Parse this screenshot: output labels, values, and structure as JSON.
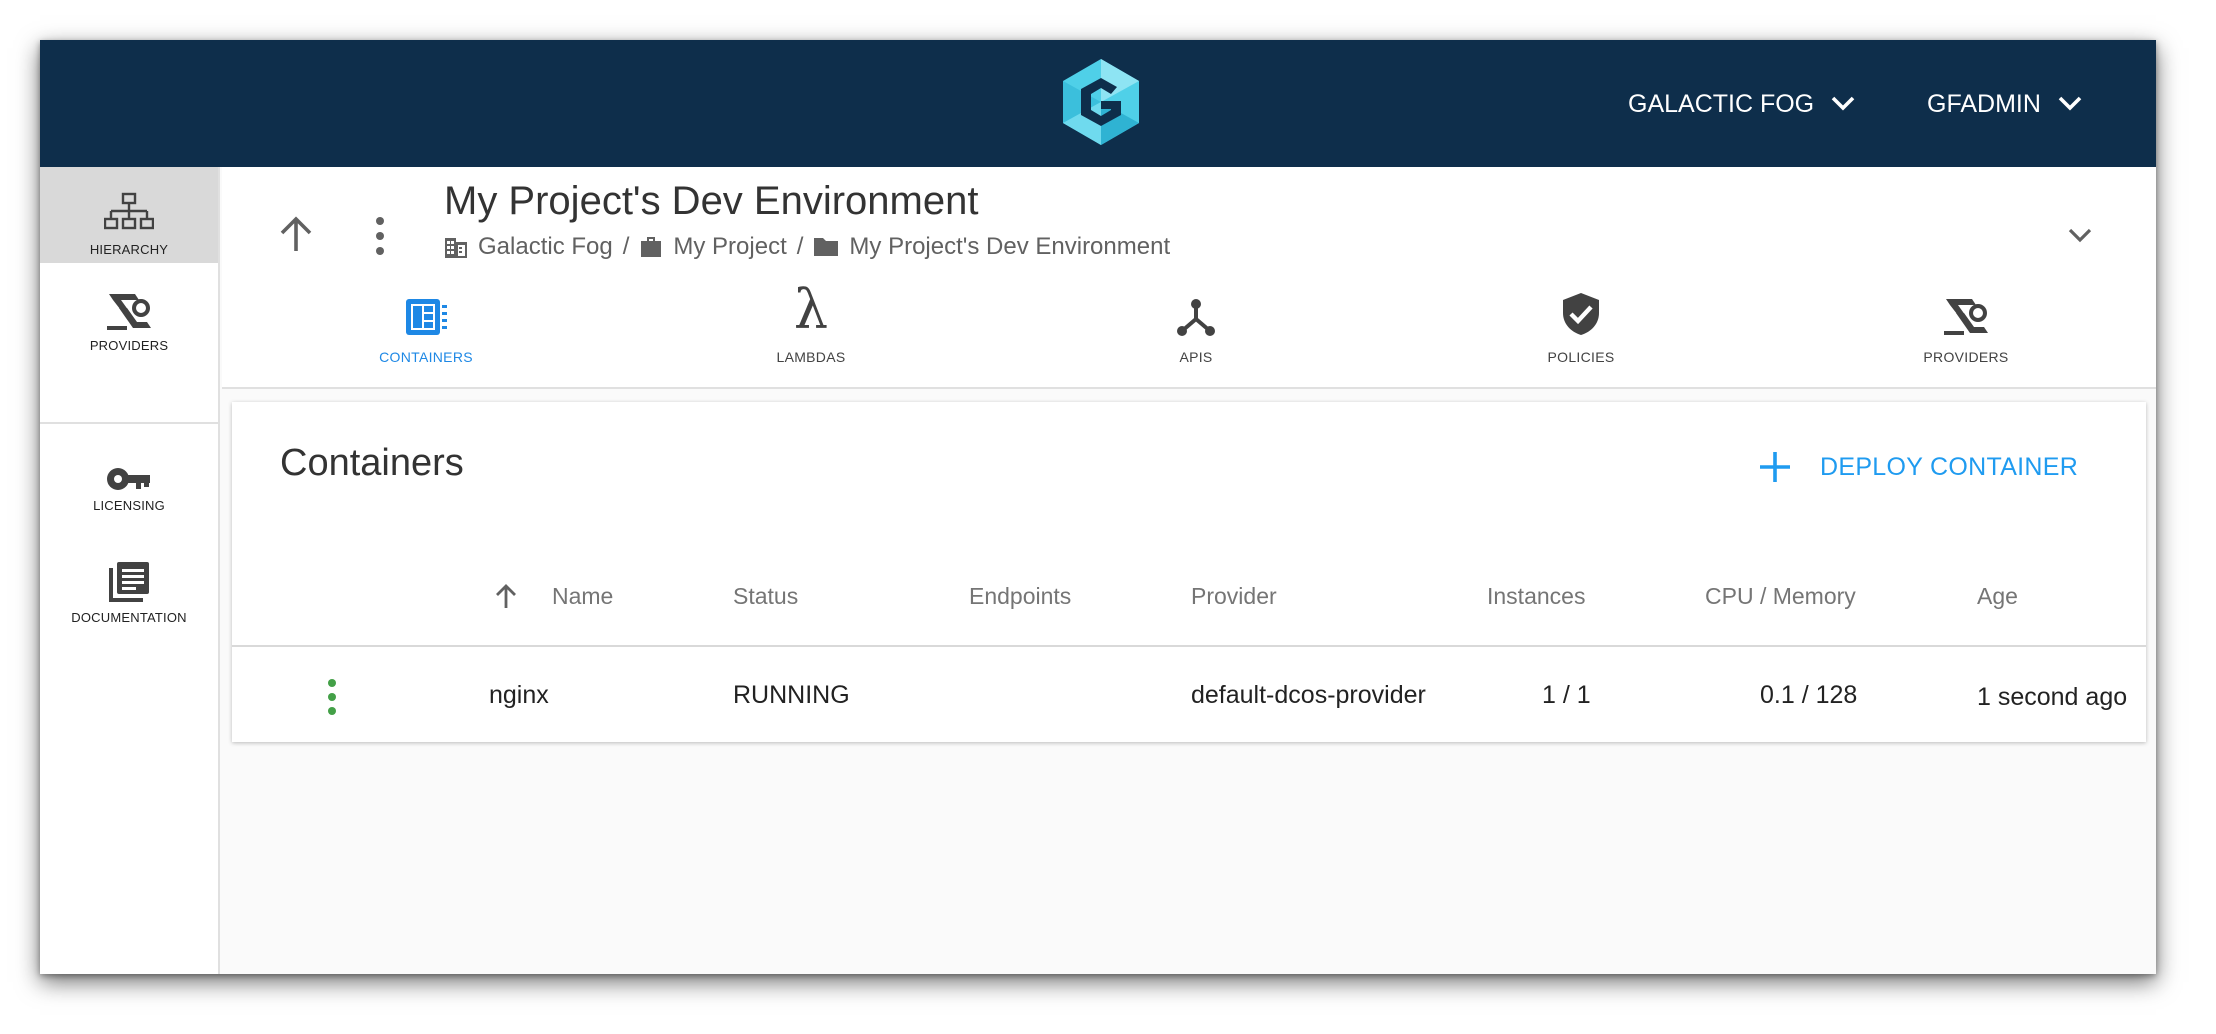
{
  "topbar": {
    "org_menu": "GALACTIC FOG",
    "user_menu": "GFADMIN",
    "colors": {
      "background": "#0e2e4b",
      "logo": "#4fd0e8"
    }
  },
  "sidenav": {
    "items": [
      {
        "label": "HIERARCHY",
        "icon": "hierarchy-icon",
        "active": true
      },
      {
        "label": "PROVIDERS",
        "icon": "providers-icon",
        "active": false
      },
      {
        "label": "LICENSING",
        "icon": "key-icon",
        "active": false
      },
      {
        "label": "DOCUMENTATION",
        "icon": "documentation-icon",
        "active": false
      }
    ]
  },
  "header": {
    "title": "My Project's Dev Environment",
    "breadcrumb": [
      {
        "label": "Galactic Fog",
        "icon": "organization-icon"
      },
      {
        "label": "My Project",
        "icon": "briefcase-icon"
      },
      {
        "label": "My Project's Dev Environment",
        "icon": "folder-icon"
      }
    ],
    "separator": "/"
  },
  "tabs": [
    {
      "label": "CONTAINERS",
      "icon": "containers-icon",
      "active": true
    },
    {
      "label": "LAMBDAS",
      "icon": "lambda-icon",
      "active": false
    },
    {
      "label": "APIS",
      "icon": "apis-icon",
      "active": false
    },
    {
      "label": "POLICIES",
      "icon": "policy-shield-icon",
      "active": false
    },
    {
      "label": "PROVIDERS",
      "icon": "providers-icon",
      "active": false
    }
  ],
  "containers": {
    "title": "Containers",
    "deploy_label": "DEPLOY CONTAINER",
    "columns": [
      "Name",
      "Status",
      "Endpoints",
      "Provider",
      "Instances",
      "CPU / Memory",
      "Age"
    ],
    "sort_column": "Name",
    "rows": [
      {
        "name": "nginx",
        "status": "RUNNING",
        "endpoints": "",
        "provider": "default-dcos-provider",
        "instances": "1 / 1",
        "cpu_memory": "0.1 / 128",
        "age": "1 second ago"
      }
    ]
  },
  "colors": {
    "accent": "#1f9bf0",
    "running": "#43a047"
  }
}
